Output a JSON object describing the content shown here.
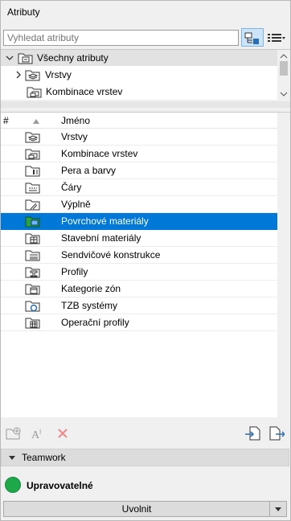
{
  "window": {
    "title": "Atributy"
  },
  "search": {
    "placeholder": "Vyhledat atributy"
  },
  "tree": {
    "root_label": "Všechny atributy",
    "items": [
      {
        "label": "Vrstvy"
      },
      {
        "label": "Kombinace vrstev"
      }
    ]
  },
  "list": {
    "columns": {
      "hash": "#",
      "name": "Jméno"
    },
    "rows": [
      {
        "label": "Vrstvy",
        "icon": "layers-folder-icon"
      },
      {
        "label": "Kombinace vrstev",
        "icon": "layer-combinations-folder-icon"
      },
      {
        "label": "Pera a barvy",
        "icon": "pens-colors-folder-icon"
      },
      {
        "label": "Čáry",
        "icon": "lines-folder-icon"
      },
      {
        "label": "Výplně",
        "icon": "fills-folder-icon"
      },
      {
        "label": "Povrchové materiály",
        "icon": "surfaces-folder-icon",
        "selected": true
      },
      {
        "label": "Stavební materiály",
        "icon": "building-materials-folder-icon"
      },
      {
        "label": "Sendvičové konstrukce",
        "icon": "composites-folder-icon"
      },
      {
        "label": "Profily",
        "icon": "profiles-folder-icon"
      },
      {
        "label": "Kategorie zón",
        "icon": "zone-categories-folder-icon"
      },
      {
        "label": "TZB systémy",
        "icon": "mep-systems-folder-icon"
      },
      {
        "label": "Operační profily",
        "icon": "operation-profiles-folder-icon"
      }
    ]
  },
  "teamwork": {
    "header": "Teamwork",
    "status": "Upravovatelné",
    "status_color": "#1ea84a",
    "release_label": "Uvolnit"
  },
  "colors": {
    "selection": "#0078d7",
    "accent_button": "#cce4f7"
  }
}
